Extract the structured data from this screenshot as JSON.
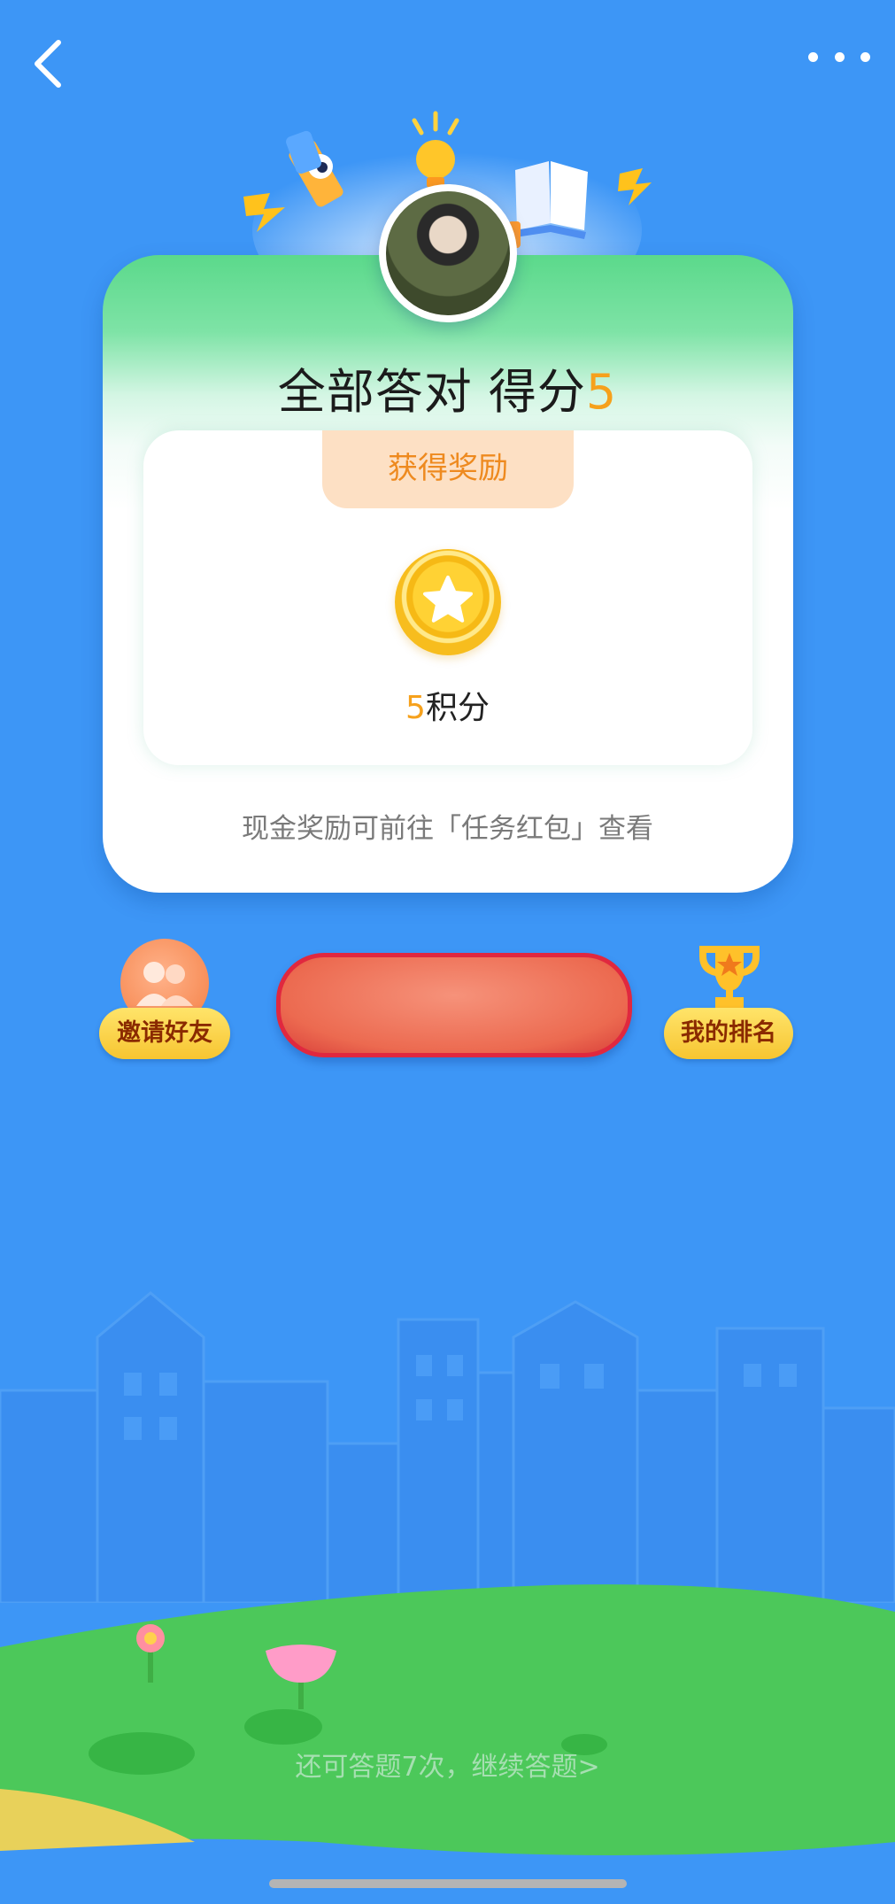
{
  "header": {
    "back_icon": "chevron-left-icon",
    "more_icon": "more-dots-icon"
  },
  "result": {
    "title_prefix": "全部答对 得分",
    "score": "5"
  },
  "reward": {
    "tab_label": "获得奖励",
    "coin_icon": "star-coin-icon",
    "points_value": "5",
    "points_unit": "积分",
    "note": "现金奖励可前往「任务红包」查看"
  },
  "actions": {
    "invite_label": "邀请好友",
    "invite_icon": "friends-icon",
    "rank_label": "我的排名",
    "rank_icon": "trophy-icon"
  },
  "footer": {
    "continue_text": "还可答题7次，继续答题>"
  },
  "colors": {
    "background": "#3d96f6",
    "accent_orange": "#f6a11c",
    "grass_green": "#4cc85a",
    "main_button": "#ec6a50"
  }
}
